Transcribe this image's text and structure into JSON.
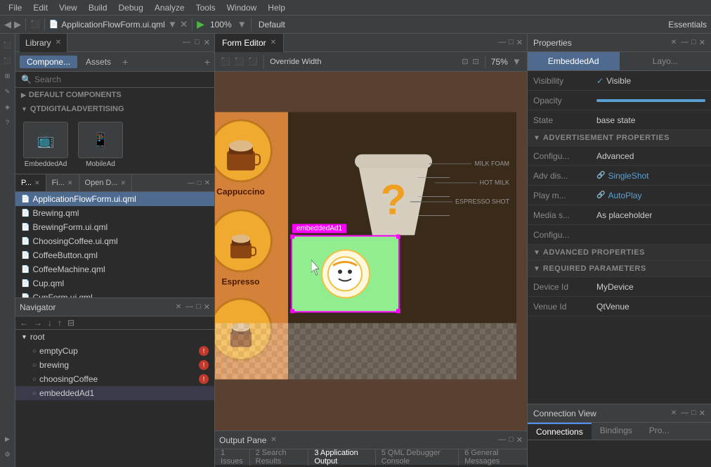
{
  "menubar": {
    "items": [
      "File",
      "Edit",
      "View",
      "Build",
      "Debug",
      "Analyze",
      "Tools",
      "Window",
      "Help"
    ]
  },
  "toolbar": {
    "filename": "ApplicationFlowForm.ui.qml",
    "zoom": "100%",
    "mode": "Default",
    "workspace": "Essentials"
  },
  "library": {
    "panel_label": "Library",
    "tabs": [
      {
        "label": "Compone...",
        "active": true
      },
      {
        "label": "Assets",
        "active": false
      }
    ],
    "search_placeholder": "Search",
    "sections": [
      {
        "label": "DEFAULT COMPONENTS",
        "collapsed": true
      },
      {
        "label": "QTDIGITALADVERTISING",
        "collapsed": false
      }
    ],
    "components": [
      {
        "label": "EmbeddedAd"
      },
      {
        "label": "MobileAd"
      }
    ]
  },
  "file_tabs": {
    "tabs": [
      {
        "label": "P...",
        "closable": true,
        "active": false
      },
      {
        "label": "Fi...",
        "closable": true,
        "active": false
      },
      {
        "label": "Open D...",
        "closable": true,
        "active": false
      }
    ],
    "files": [
      {
        "label": "ApplicationFlowForm.ui.qml",
        "selected": true
      },
      {
        "label": "Brewing.qml",
        "selected": false
      },
      {
        "label": "BrewingForm.ui.qml",
        "selected": false
      },
      {
        "label": "ChoosingCoffee.ui.qml",
        "selected": false
      },
      {
        "label": "CoffeeButton.qml",
        "selected": false
      },
      {
        "label": "CoffeeMachine.qml",
        "selected": false
      },
      {
        "label": "Cup.qml",
        "selected": false
      },
      {
        "label": "CupForm.ui.qml",
        "selected": false
      }
    ]
  },
  "navigator": {
    "label": "Navigator",
    "items": [
      {
        "label": "root",
        "indent": 0,
        "type": "folder",
        "badge": false
      },
      {
        "label": "emptyCup",
        "indent": 1,
        "type": "object",
        "badge": true
      },
      {
        "label": "brewing",
        "indent": 1,
        "type": "object",
        "badge": true
      },
      {
        "label": "choosingCoffee",
        "indent": 1,
        "type": "object",
        "badge": true
      },
      {
        "label": "embeddedAd1",
        "indent": 1,
        "type": "object",
        "badge": false,
        "selected": true
      }
    ]
  },
  "editor": {
    "tabs": [
      {
        "label": "Form Editor",
        "active": true,
        "closable": true
      }
    ],
    "toolbar": {
      "override_width": "Override Width",
      "zoom": "75%"
    }
  },
  "canvas": {
    "coffee_items": [
      {
        "label": "Cappuccino"
      },
      {
        "label": "Espresso"
      }
    ],
    "embedded_ad_label": "embeddedAd1",
    "cup_labels": [
      "MILK FOAM",
      "HOT MILK",
      "ESPRESSO SHOT"
    ]
  },
  "output_pane": {
    "label": "Output Pane",
    "tabs": [
      {
        "num": 1,
        "label": "Issues"
      },
      {
        "num": 2,
        "label": "Search Results"
      },
      {
        "num": 3,
        "label": "Application Output",
        "active": true
      },
      {
        "num": 5,
        "label": "QML Debugger Console"
      },
      {
        "num": 6,
        "label": "General Messages"
      }
    ]
  },
  "properties": {
    "title": "Properties",
    "tabs": [
      {
        "label": "EmbeddedAd",
        "active": true
      },
      {
        "label": "Layo...",
        "active": false
      }
    ],
    "rows": [
      {
        "label": "Visibility",
        "type": "check",
        "value": "Visible"
      },
      {
        "label": "Opacity",
        "type": "text",
        "value": ""
      },
      {
        "label": "State",
        "type": "text",
        "value": "base state"
      }
    ],
    "ad_section": {
      "title": "ADVERTISEMENT PROPERTIES",
      "rows": [
        {
          "label": "Configu...",
          "value": "Advanced",
          "type": "text"
        },
        {
          "label": "Adv dis...",
          "value": "SingleShot",
          "type": "link"
        },
        {
          "label": "Play m...",
          "value": "AutoPlay",
          "type": "link"
        },
        {
          "label": "Media s...",
          "value": "As placeholder",
          "type": "text"
        },
        {
          "label": "Configu...",
          "value": "",
          "type": "text"
        }
      ]
    },
    "advanced_section": {
      "title": "ADVANCED PROPERTIES"
    },
    "required_section": {
      "title": "REQUIRED PARAMETERS",
      "rows": [
        {
          "label": "Device Id",
          "value": "MyDevice",
          "type": "text"
        },
        {
          "label": "Venue Id",
          "value": "QtVenue",
          "type": "text"
        }
      ]
    }
  },
  "connection_view": {
    "title": "Connection View",
    "tabs": [
      {
        "label": "Connections",
        "active": true
      },
      {
        "label": "Bindings",
        "active": false
      },
      {
        "label": "Pro...",
        "active": false
      }
    ]
  },
  "icons": {
    "arrow_right": "▶",
    "arrow_down": "▼",
    "arrow_left": "◀",
    "close": "✕",
    "check": "✓",
    "search": "🔍",
    "plus": "+",
    "folder": "📁",
    "link": "🔗",
    "nav_back": "←",
    "nav_forward": "→",
    "nav_down": "↓",
    "nav_up": "↑",
    "nav_filter": "⊟"
  }
}
